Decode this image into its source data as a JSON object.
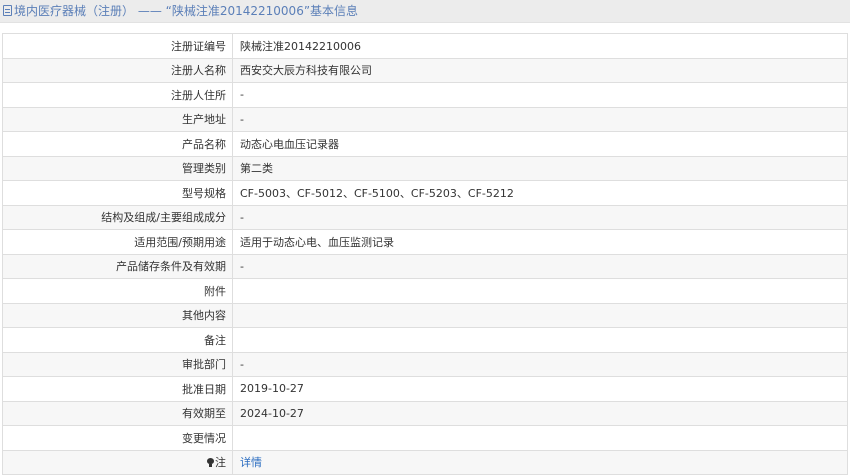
{
  "header": {
    "title": "境内医疗器械（注册） —— “陕械注准20142210006”基本信息"
  },
  "rows": [
    {
      "label": "注册证编号",
      "value": "陕械注准20142210006"
    },
    {
      "label": "注册人名称",
      "value": "西安交大辰方科技有限公司"
    },
    {
      "label": "注册人住所",
      "value": "-"
    },
    {
      "label": "生产地址",
      "value": "-"
    },
    {
      "label": "产品名称",
      "value": "动态心电血压记录器"
    },
    {
      "label": "管理类别",
      "value": "第二类"
    },
    {
      "label": "型号规格",
      "value": "CF-5003、CF-5012、CF-5100、CF-5203、CF-5212"
    },
    {
      "label": "结构及组成/主要组成成分",
      "value": "-"
    },
    {
      "label": "适用范围/预期用途",
      "value": "适用于动态心电、血压监测记录"
    },
    {
      "label": "产品储存条件及有效期",
      "value": "-"
    },
    {
      "label": "附件",
      "value": ""
    },
    {
      "label": "其他内容",
      "value": ""
    },
    {
      "label": "备注",
      "value": ""
    },
    {
      "label": "审批部门",
      "value": "-"
    },
    {
      "label": "批准日期",
      "value": "2019-10-27"
    },
    {
      "label": "有效期至",
      "value": "2024-10-27"
    },
    {
      "label": "变更情况",
      "value": ""
    }
  ],
  "note": {
    "label": "注",
    "link": "详情",
    "icon": "bulb-icon"
  }
}
